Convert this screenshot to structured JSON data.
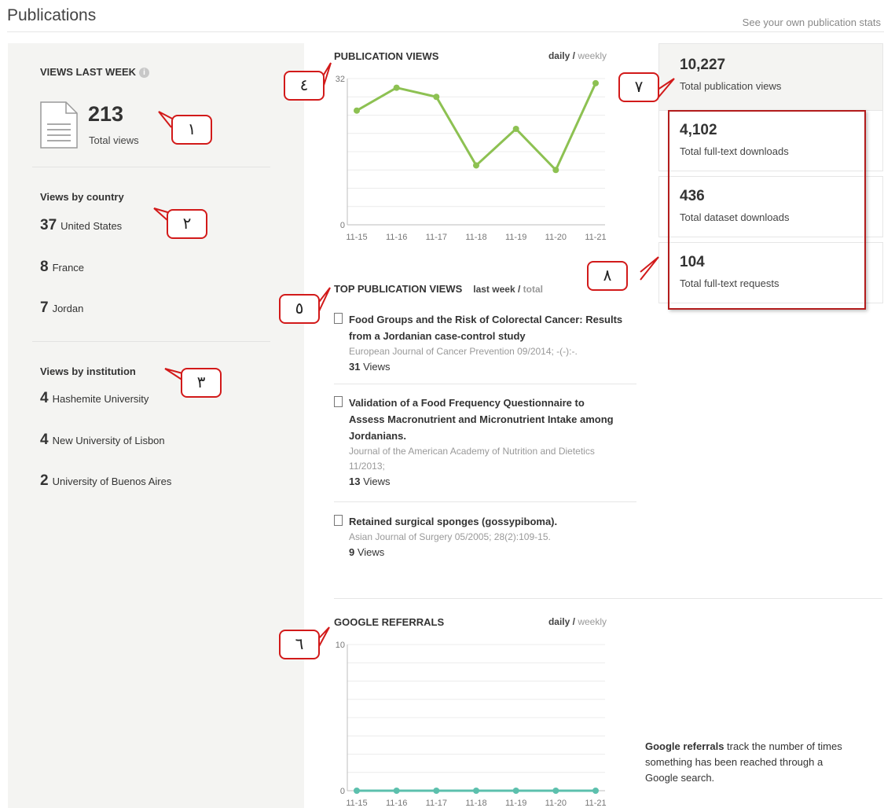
{
  "header": {
    "title": "Publications",
    "own_stats_link": "See your own publication stats"
  },
  "views_last_week": {
    "heading": "VIEWS LAST WEEK",
    "total": "213",
    "total_label": "Total views",
    "by_country_heading": "Views by country",
    "by_country": [
      {
        "count": "37",
        "name": "United States"
      },
      {
        "count": "8",
        "name": "France"
      },
      {
        "count": "7",
        "name": "Jordan"
      }
    ],
    "by_institution_heading": "Views by institution",
    "by_institution": [
      {
        "count": "4",
        "name": "Hashemite University"
      },
      {
        "count": "4",
        "name": "New University of Lisbon"
      },
      {
        "count": "2",
        "name": "University of Buenos Aires"
      }
    ]
  },
  "publication_views": {
    "title": "PUBLICATION VIEWS",
    "toggle_active": "daily",
    "toggle_sep": " / ",
    "toggle_inactive": "weekly"
  },
  "top_publication_views": {
    "title": "TOP PUBLICATION VIEWS",
    "toggle_active": "last week",
    "toggle_sep": " / ",
    "toggle_inactive": "total",
    "items": [
      {
        "title": "Food Groups and the Risk of Colorectal Cancer: Results from a Jordanian case-control study",
        "meta": "European Journal of Cancer Prevention 09/2014; -(-):-.",
        "views_count": "31",
        "views_label": " Views"
      },
      {
        "title": "Validation of a Food Frequency Questionnaire to Assess Macronutrient and Micronutrient Intake among Jordanians.",
        "meta": "Journal of the American Academy of Nutrition and Dietetics 11/2013;",
        "views_count": "13",
        "views_label": " Views"
      },
      {
        "title": "Retained surgical sponges (gossypiboma).",
        "meta": "Asian Journal of Surgery 05/2005; 28(2):109-15.",
        "views_count": "9",
        "views_label": " Views"
      }
    ]
  },
  "google_referrals": {
    "title": "GOOGLE REFERRALS",
    "toggle_active": "daily",
    "toggle_sep": " / ",
    "toggle_inactive": "weekly",
    "note_bold": "Google referrals",
    "note_rest": " track the number of times something has been reached through a Google search."
  },
  "totals": [
    {
      "value": "10,227",
      "label": "Total publication views"
    },
    {
      "value": "4,102",
      "label": "Total full-text downloads"
    },
    {
      "value": "436",
      "label": "Total dataset downloads"
    },
    {
      "value": "104",
      "label": "Total full-text requests"
    }
  ],
  "callouts": [
    "١",
    "٢",
    "٣",
    "٤",
    "٥",
    "٦",
    "٧",
    "٨"
  ],
  "colors": {
    "views_line": "#8dc152",
    "referrals_line": "#5cc0ad",
    "callout_border": "#d21a1a",
    "panel_bg": "#f4f4f2"
  },
  "chart_data": [
    {
      "type": "line",
      "x": [
        "11-15",
        "11-16",
        "11-17",
        "11-18",
        "11-19",
        "11-20",
        "11-21"
      ],
      "values": [
        25,
        30,
        28,
        13,
        21,
        12,
        31
      ],
      "ylim": [
        0,
        32
      ],
      "y_ticks": [
        "0",
        "32"
      ],
      "grid": true
    },
    {
      "type": "line",
      "x": [
        "11-15",
        "11-16",
        "11-17",
        "11-18",
        "11-19",
        "11-20",
        "11-21"
      ],
      "values": [
        0,
        0,
        0,
        0,
        0,
        0,
        0
      ],
      "ylim": [
        0,
        10
      ],
      "y_ticks": [
        "0",
        "10"
      ],
      "grid": true
    }
  ]
}
